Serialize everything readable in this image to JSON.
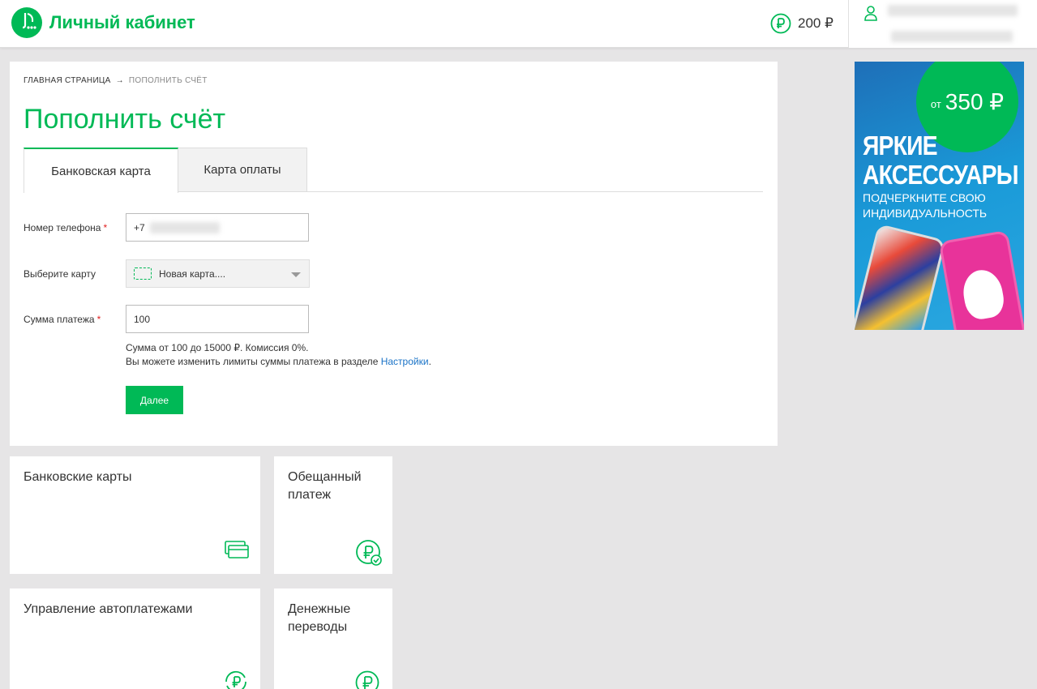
{
  "header": {
    "brand": "Личный кабинет",
    "balance": "200 ₽"
  },
  "breadcrumb": {
    "home": "ГЛАВНАЯ СТРАНИЦА",
    "separator": "→",
    "current": "ПОПОЛНИТЬ СЧЁТ"
  },
  "page_title": "Пополнить счёт",
  "tabs": [
    {
      "label": "Банковская карта",
      "active": true
    },
    {
      "label": "Карта оплаты",
      "active": false
    }
  ],
  "form": {
    "phone_label": "Номер телефона",
    "phone_prefix": "+7",
    "card_label": "Выберите карту",
    "card_value": "Новая карта....",
    "amount_label": "Сумма платежа",
    "amount_value": "100",
    "required_mark": "*",
    "hint_line1": "Сумма от 100 до 15000 ₽. Комиссия 0%.",
    "hint_line2": "Вы можете изменить лимиты суммы платежа в разделе",
    "hint_link": "Настройки",
    "hint_end": ".",
    "submit": "Далее"
  },
  "tiles": [
    {
      "title": "Банковские карты",
      "icon": "cards-icon"
    },
    {
      "title": "Обещанный платеж",
      "icon": "ruble-check-icon"
    },
    {
      "title": "Управление автоплатежами",
      "icon": "ruble-refresh-icon"
    },
    {
      "title": "Денежные переводы",
      "icon": "ruble-icon"
    }
  ],
  "ad": {
    "prefix": "от",
    "price": "350 ₽",
    "headline_1": "ЯРКИЕ",
    "headline_2": "АКСЕССУАРЫ",
    "sub_1": "ПОДЧЕРКНИТЕ СВОЮ",
    "sub_2": "ИНДИВИДУАЛЬНОСТЬ"
  },
  "colors": {
    "accent": "#00b956",
    "link": "#1a73c7",
    "background": "#e6e5e6"
  }
}
